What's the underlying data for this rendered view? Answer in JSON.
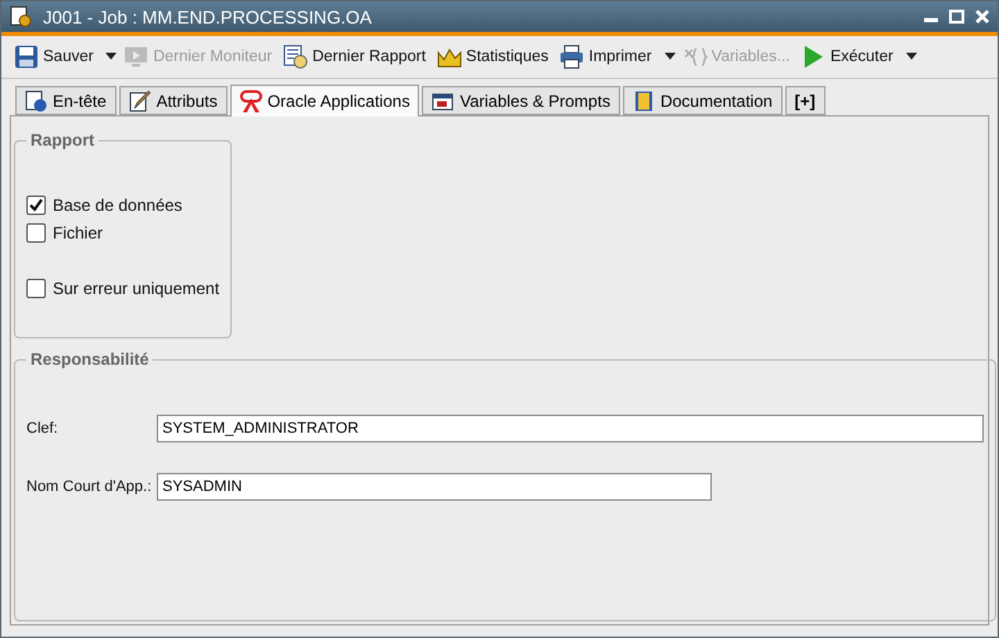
{
  "window": {
    "title": "J001 - Job : MM.END.PROCESSING.OA"
  },
  "toolbar": [
    {
      "kind": "save",
      "label": "Sauver",
      "disabled": false,
      "dropdown": true
    },
    {
      "kind": "monitor",
      "label": "Dernier Moniteur",
      "disabled": true,
      "dropdown": false
    },
    {
      "kind": "report",
      "label": "Dernier Rapport",
      "disabled": false,
      "dropdown": false
    },
    {
      "kind": "stats",
      "label": "Statistiques",
      "disabled": false,
      "dropdown": false
    },
    {
      "kind": "print",
      "label": "Imprimer",
      "disabled": false,
      "dropdown": true
    },
    {
      "kind": "variables",
      "label": "Variables...",
      "disabled": true,
      "dropdown": false
    },
    {
      "kind": "run",
      "label": "Exécuter",
      "disabled": false,
      "dropdown": true
    }
  ],
  "tabs": [
    {
      "kind": "info",
      "label": "En-tête",
      "selected": false
    },
    {
      "kind": "pencil",
      "label": "Attributs",
      "selected": false
    },
    {
      "kind": "oracle",
      "label": "Oracle Applications",
      "selected": true
    },
    {
      "kind": "vars",
      "label": "Variables & Prompts",
      "selected": false
    },
    {
      "kind": "book",
      "label": "Documentation",
      "selected": false
    },
    {
      "kind": "add",
      "label": "[+]",
      "selected": false
    }
  ],
  "rapport": {
    "title": "Rapport",
    "options": [
      {
        "label": "Base de données",
        "checked": true
      },
      {
        "label": "Fichier",
        "checked": false
      },
      {
        "label": "Sur erreur uniquement",
        "checked": false
      }
    ]
  },
  "responsabilite": {
    "title": "Responsabilité",
    "fields": [
      {
        "label": "Clef:",
        "value": "SYSTEM_ADMINISTRATOR"
      },
      {
        "label": "Nom Court d'App.:",
        "value": "SYSADMIN"
      }
    ]
  }
}
